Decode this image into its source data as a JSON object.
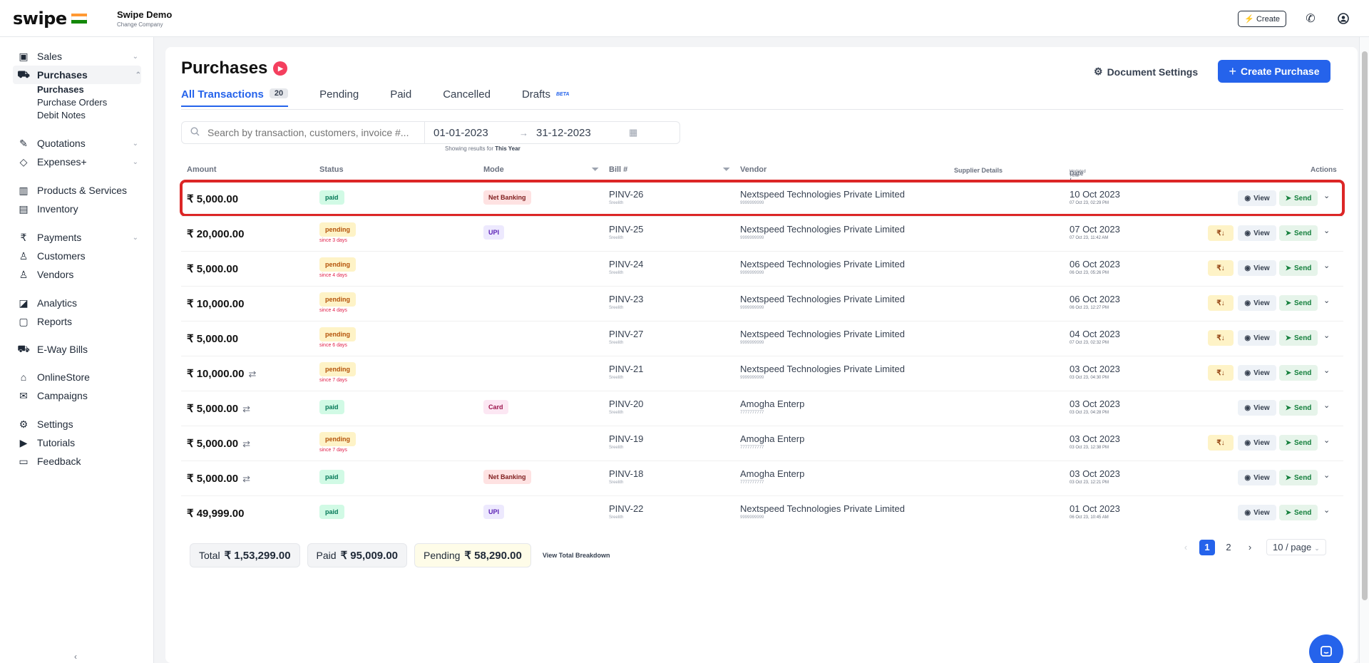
{
  "brand": {
    "logo": "swipe",
    "company_name": "Swipe Demo",
    "change_company": "Change Company"
  },
  "topbar": {
    "create_label": "⚡ Create"
  },
  "sidebar": {
    "items": [
      {
        "label": "Sales",
        "icon": "cash-icon",
        "glyph": "▣",
        "chevron": "⌄"
      },
      {
        "label": "Purchases",
        "icon": "cart-icon",
        "glyph": "⛟",
        "chevron": "⌃"
      },
      {
        "label": "Quotations",
        "icon": "pen-icon",
        "glyph": "✎",
        "chevron": "⌄"
      },
      {
        "label": "Expenses+",
        "icon": "tag-icon",
        "glyph": "◇",
        "chevron": "⌄"
      },
      {
        "label": "Products & Services",
        "icon": "barcode-icon",
        "glyph": "▥"
      },
      {
        "label": "Inventory",
        "icon": "warehouse-icon",
        "glyph": "▤"
      },
      {
        "label": "Payments",
        "icon": "rupee-icon",
        "glyph": "₹",
        "chevron": "⌄"
      },
      {
        "label": "Customers",
        "icon": "user-icon",
        "glyph": "♙"
      },
      {
        "label": "Vendors",
        "icon": "users-icon",
        "glyph": "♙"
      },
      {
        "label": "Analytics",
        "icon": "chart-icon",
        "glyph": "◪"
      },
      {
        "label": "Reports",
        "icon": "report-icon",
        "glyph": "▢"
      },
      {
        "label": "E-Way Bills",
        "icon": "truck-icon",
        "glyph": "⛟"
      },
      {
        "label": "OnlineStore",
        "icon": "store-icon",
        "glyph": "⌂"
      },
      {
        "label": "Campaigns",
        "icon": "megaphone-icon",
        "glyph": "✉"
      },
      {
        "label": "Settings",
        "icon": "gear-icon",
        "glyph": "⚙"
      },
      {
        "label": "Tutorials",
        "icon": "youtube-icon",
        "glyph": "▶"
      },
      {
        "label": "Feedback",
        "icon": "chat-icon",
        "glyph": "▭"
      }
    ],
    "sub_items": [
      "Purchases",
      "Purchase Orders",
      "Debit Notes"
    ]
  },
  "main": {
    "title": "Purchases",
    "document_settings": "Document Settings",
    "create_purchase": "Create Purchase",
    "tabs": [
      {
        "label": "All Transactions",
        "count": "20"
      },
      {
        "label": "Pending"
      },
      {
        "label": "Paid"
      },
      {
        "label": "Cancelled"
      },
      {
        "label": "Drafts",
        "badge": "BETA"
      }
    ],
    "search": {
      "placeholder": "Search by transaction, customers, invoice #...",
      "date_from": "01-01-2023",
      "date_to": "31-12-2023",
      "note_prefix": "Showing results for",
      "note_period": "This Year"
    },
    "columns": [
      "Amount",
      "Status",
      "Mode",
      "Bill #",
      "Vendor",
      "Supplier Details",
      "Date /",
      "Updated Time",
      "Actions"
    ],
    "rows": [
      {
        "amount": "₹ 5,000.00",
        "status": "paid",
        "since": "",
        "mode": "Net Banking",
        "bill": "PINV-26",
        "bill_sub": "Sreelith",
        "vendor": "Nextspeed Technologies Private Limited",
        "vendor_sub": "9999999999",
        "date": "10 Oct 2023",
        "updated": "07 Oct 23, 02:29 PM",
        "pay": false,
        "recurring": false
      },
      {
        "amount": "₹ 20,000.00",
        "status": "pending",
        "since": "since 3 days",
        "mode": "UPI",
        "bill": "PINV-25",
        "bill_sub": "Sreelith",
        "vendor": "Nextspeed Technologies Private Limited",
        "vendor_sub": "9999999999",
        "date": "07 Oct 2023",
        "updated": "07 Oct 23, 11:42 AM",
        "pay": true,
        "recurring": false
      },
      {
        "amount": "₹ 5,000.00",
        "status": "pending",
        "since": "since 4 days",
        "mode": "",
        "bill": "PINV-24",
        "bill_sub": "Sreelith",
        "vendor": "Nextspeed Technologies Private Limited",
        "vendor_sub": "9999999999",
        "date": "06 Oct 2023",
        "updated": "06 Oct 23, 05:26 PM",
        "pay": true,
        "recurring": false
      },
      {
        "amount": "₹ 10,000.00",
        "status": "pending",
        "since": "since 4 days",
        "mode": "",
        "bill": "PINV-23",
        "bill_sub": "Sreelith",
        "vendor": "Nextspeed Technologies Private Limited",
        "vendor_sub": "9999999999",
        "date": "06 Oct 2023",
        "updated": "06 Oct 23, 12:27 PM",
        "pay": true,
        "recurring": false
      },
      {
        "amount": "₹ 5,000.00",
        "status": "pending",
        "since": "since 6 days",
        "mode": "",
        "bill": "PINV-27",
        "bill_sub": "Sreelith",
        "vendor": "Nextspeed Technologies Private Limited",
        "vendor_sub": "9999999999",
        "date": "04 Oct 2023",
        "updated": "07 Oct 23, 02:32 PM",
        "pay": true,
        "recurring": false
      },
      {
        "amount": "₹ 10,000.00",
        "status": "pending",
        "since": "since 7 days",
        "mode": "",
        "bill": "PINV-21",
        "bill_sub": "Sreelith",
        "vendor": "Nextspeed Technologies Private Limited",
        "vendor_sub": "9999999999",
        "date": "03 Oct 2023",
        "updated": "03 Oct 23, 04:30 PM",
        "pay": true,
        "recurring": true
      },
      {
        "amount": "₹ 5,000.00",
        "status": "paid",
        "since": "",
        "mode": "Card",
        "bill": "PINV-20",
        "bill_sub": "Sreelith",
        "vendor": "Amogha Enterp",
        "vendor_sub": "7777777777",
        "date": "03 Oct 2023",
        "updated": "03 Oct 23, 04:28 PM",
        "pay": false,
        "recurring": true
      },
      {
        "amount": "₹ 5,000.00",
        "status": "pending",
        "since": "since 7 days",
        "mode": "",
        "bill": "PINV-19",
        "bill_sub": "Sreelith",
        "vendor": "Amogha Enterp",
        "vendor_sub": "7777777777",
        "date": "03 Oct 2023",
        "updated": "03 Oct 23, 12:38 PM",
        "pay": true,
        "recurring": true
      },
      {
        "amount": "₹ 5,000.00",
        "status": "paid",
        "since": "",
        "mode": "Net Banking",
        "bill": "PINV-18",
        "bill_sub": "Sreelith",
        "vendor": "Amogha Enterp",
        "vendor_sub": "7777777777",
        "date": "03 Oct 2023",
        "updated": "03 Oct 23, 12:21 PM",
        "pay": false,
        "recurring": true
      },
      {
        "amount": "₹ 49,999.00",
        "status": "paid",
        "since": "",
        "mode": "UPI",
        "bill": "PINV-22",
        "bill_sub": "Sreelith",
        "vendor": "Nextspeed Technologies Private Limited",
        "vendor_sub": "9999999999",
        "date": "01 Oct 2023",
        "updated": "06 Oct 23, 10:45 AM",
        "pay": false,
        "recurring": false
      }
    ],
    "row_actions": {
      "pay": "₹↓",
      "view": "View",
      "send": "Send"
    },
    "totals": {
      "total_label": "Total",
      "total_value": "₹ 1,53,299.00",
      "paid_label": "Paid",
      "paid_value": "₹ 95,009.00",
      "pending_label": "Pending",
      "pending_value": "₹ 58,290.00",
      "breakdown": "View Total Breakdown"
    },
    "pagination": {
      "pages": [
        "1",
        "2"
      ],
      "page_size": "10 / page"
    }
  }
}
